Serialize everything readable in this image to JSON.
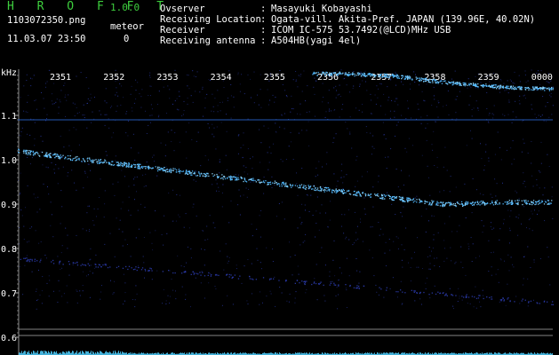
{
  "app": {
    "title": "H R O F F T",
    "version": "1.0.0"
  },
  "file": {
    "name": "1103072350.png",
    "datetime": "11.03.07 23:50"
  },
  "meteor": {
    "label": "meteor",
    "count": "0"
  },
  "info": [
    {
      "label": "Ovserver",
      "value": "Masayuki Kobayashi"
    },
    {
      "label": "Receiving Location",
      "value": "Ogata-vill. Akita-Pref. JAPAN (139.96E, 40.02N)"
    },
    {
      "label": "Receiver",
      "value": "ICOM IC-575 53.7492(@LCD)MHz USB"
    },
    {
      "label": "Receiving antenna",
      "value": "A504HB(yagi 4el)"
    }
  ],
  "colors": {
    "title_green": "#3ecf3e",
    "signal": "#4fb8ff",
    "noise": "#2a3aa8",
    "reference": "#2f6fe0",
    "grid": "#b0b0b0",
    "text": "#ffffff"
  },
  "chart_data": {
    "type": "heatmap",
    "ylabel": "kHz",
    "time_ticks": [
      "2351",
      "2352",
      "2353",
      "2354",
      "2355",
      "2356",
      "2357",
      "2358",
      "2359",
      "0000"
    ],
    "y_ticks": [
      "1.1",
      "1.0",
      "0.9",
      "0.8",
      "0.7",
      "0.6"
    ],
    "ylim": [
      0.58,
      1.2
    ],
    "reference_line_khz": 1.09,
    "horizontal_marks_khz": [
      0.618,
      0.604
    ],
    "signals": [
      {
        "name_hint": "upper",
        "x_minutes": [
          0,
          6,
          7,
          8,
          9,
          10
        ],
        "y_khz": [
          1.19,
          1.195,
          1.19,
          1.175,
          1.165,
          1.16
        ]
      },
      {
        "name_hint": "main",
        "x_minutes": [
          0,
          1,
          2,
          3,
          4,
          5,
          6,
          7,
          8,
          9,
          10
        ],
        "y_khz": [
          1.02,
          1.005,
          0.99,
          0.975,
          0.96,
          0.945,
          0.93,
          0.915,
          0.9,
          0.905,
          0.905
        ]
      },
      {
        "name_hint": "faint",
        "x_minutes": [
          0,
          1,
          2,
          3,
          4,
          5,
          6,
          7,
          8,
          9,
          10
        ],
        "y_khz": [
          0.778,
          0.768,
          0.758,
          0.748,
          0.738,
          0.728,
          0.718,
          0.708,
          0.698,
          0.688,
          0.678
        ]
      }
    ]
  }
}
